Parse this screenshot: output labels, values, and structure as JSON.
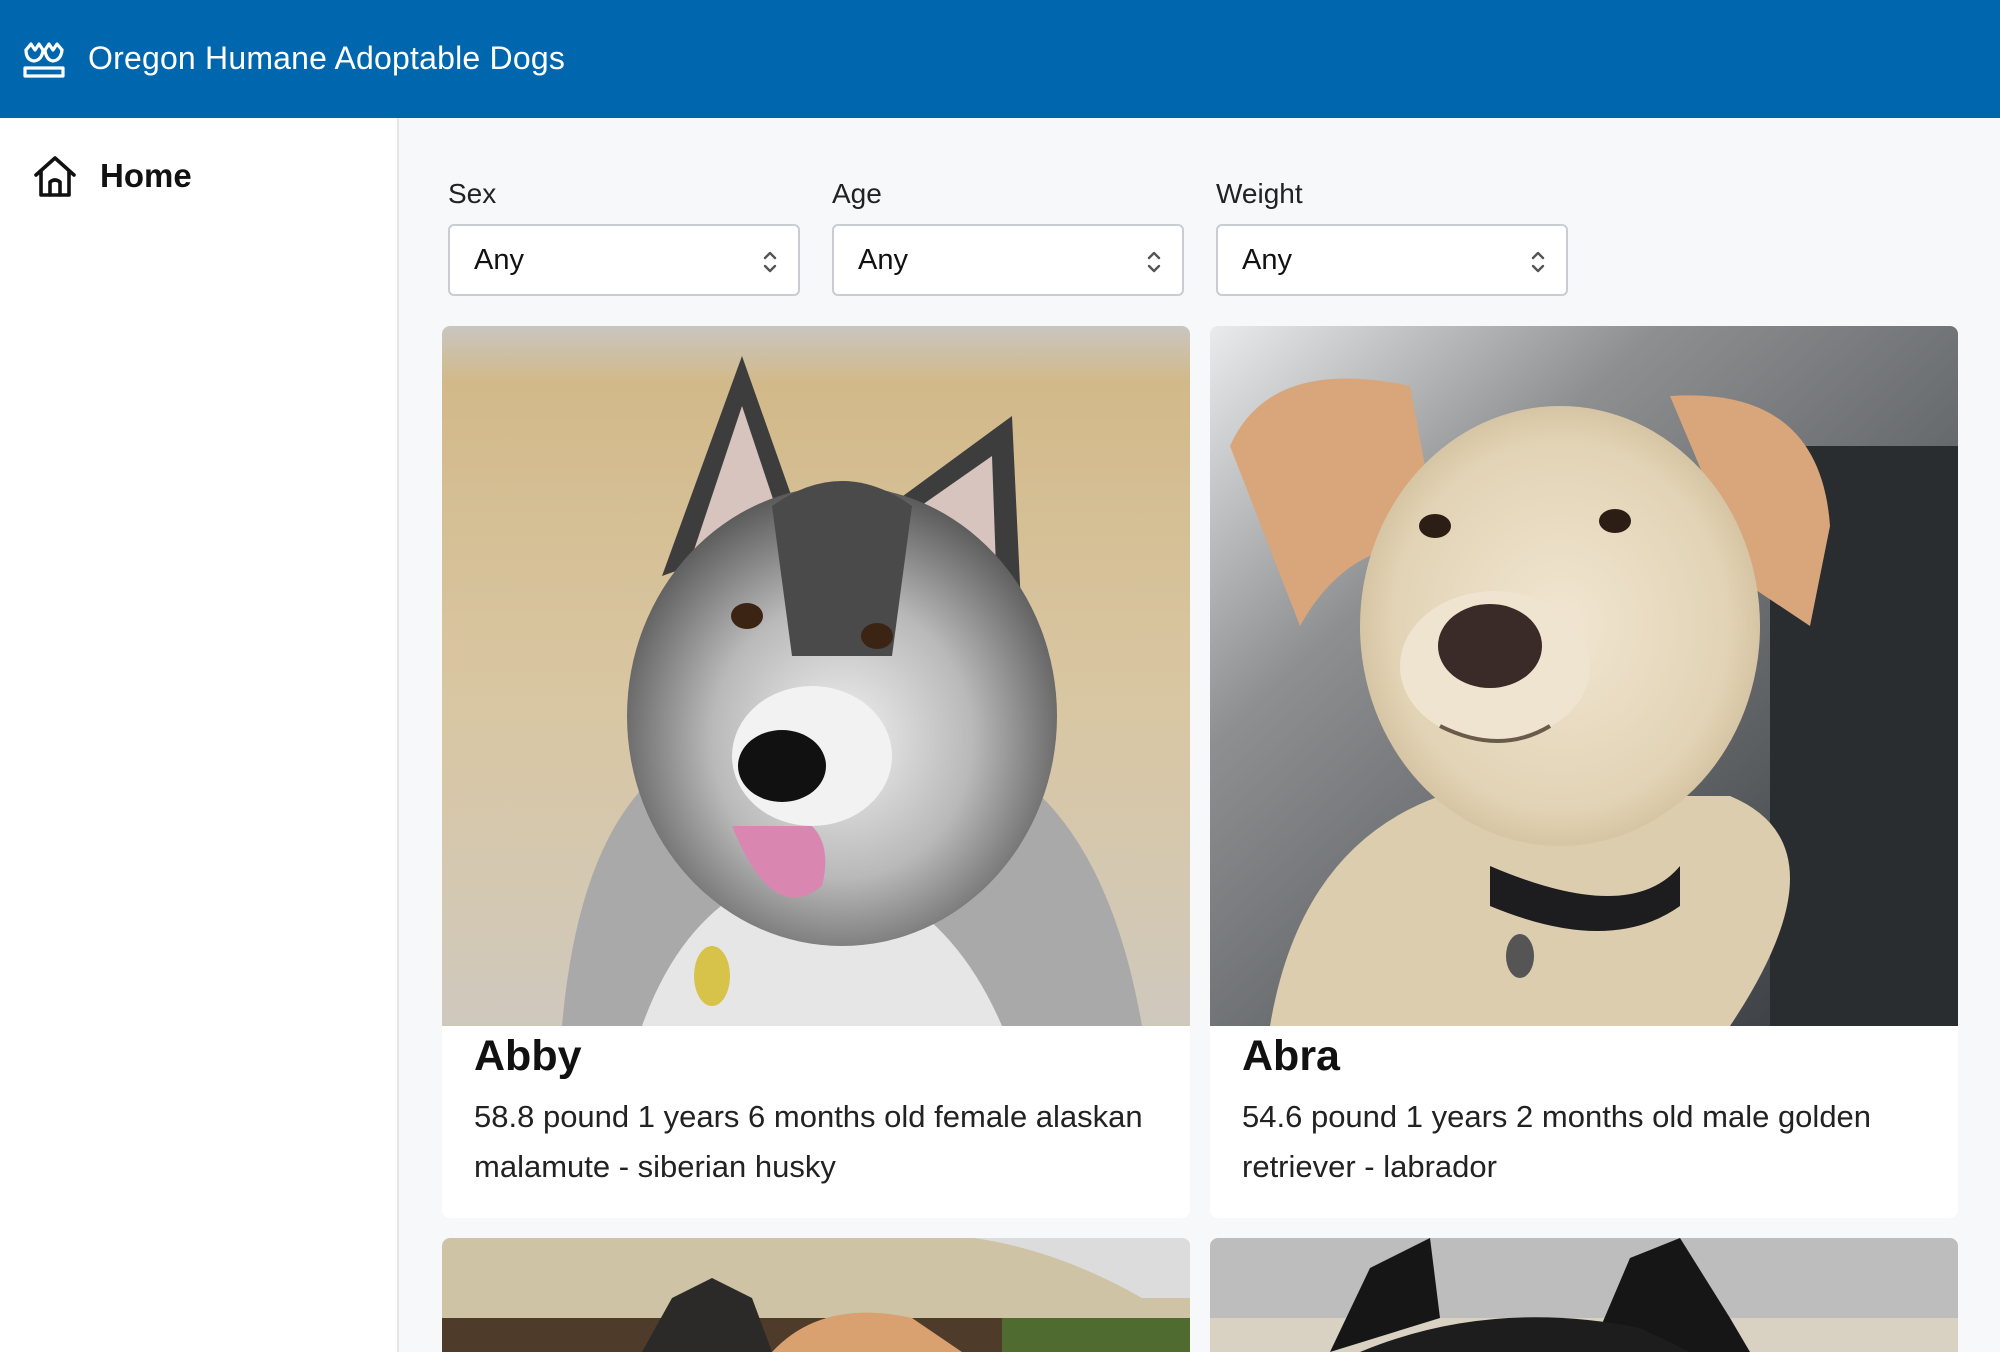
{
  "app": {
    "title": "Oregon Humane Adoptable Dogs",
    "brand_color": "#0066ad"
  },
  "sidebar": {
    "items": [
      {
        "label": "Home",
        "icon": "home-icon"
      }
    ]
  },
  "filters": [
    {
      "label": "Sex",
      "value": "Any"
    },
    {
      "label": "Age",
      "value": "Any"
    },
    {
      "label": "Weight",
      "value": "Any"
    }
  ],
  "dogs": [
    {
      "name": "Abby",
      "description": "58.8 pound 1 years 6 months old female alaskan malamute - siberian husky"
    },
    {
      "name": "Abra",
      "description": "54.6 pound 1 years 2 months old male golden retriever - labrador"
    }
  ]
}
